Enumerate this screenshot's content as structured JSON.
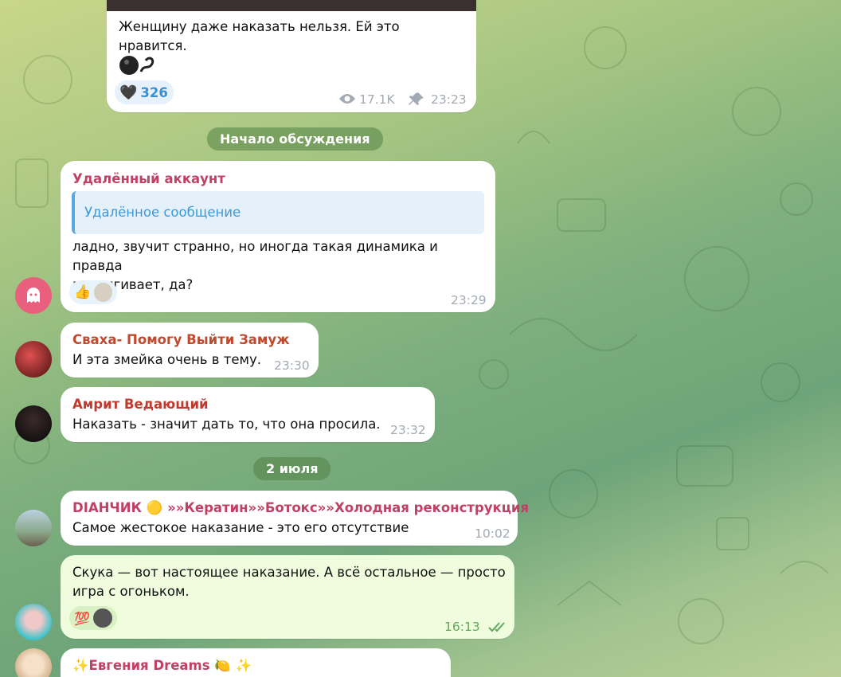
{
  "top_post": {
    "text": "Женщину даже наказать нельзя. Ей это нравится.",
    "reaction_emoji": "🖤",
    "reaction_count": "326",
    "views": "17.1K",
    "time": "23:23"
  },
  "discussion_pill": "Начало обсуждения",
  "date_pill": "2 июля",
  "messages": [
    {
      "author": "Удалённый аккаунт",
      "quote": "Удалённое сообщение",
      "text_line1": "ладно, звучит странно, но иногда такая динамика и правда",
      "text_line2": "притягивает, да?",
      "reaction_emoji": "👍",
      "time": "23:29"
    },
    {
      "author": "Сваха- Помогу Выйти Замуж",
      "text": "И эта змейка очень в тему.",
      "time": "23:30"
    },
    {
      "author": "Амрит Ведающий",
      "text": "Наказать - значит дать то, что она просила.",
      "time": "23:32"
    },
    {
      "author": "DIAНЧИК 🟡 »»Кератин»»Ботокс»»Холодная реконструкция",
      "text": "Самое жестокое наказание - это его отсутствие",
      "time": "10:02"
    },
    {
      "text_line1": "Скука — вот настоящее наказание. А всё остальное — просто",
      "text_line2": "игра с огоньком.",
      "reaction_emoji": "💯",
      "time": "16:13"
    },
    {
      "author": "✨Евгения Dreams 🍋 ✨"
    }
  ],
  "colors": {
    "author_pink": "#c04166",
    "author_red": "#bf3a2f",
    "own_bubble": "#effdde",
    "check": "#62a85c"
  },
  "icons": [
    "eye-icon",
    "pin-icon",
    "ghost-icon",
    "double-check-icon",
    "snake-icon"
  ]
}
